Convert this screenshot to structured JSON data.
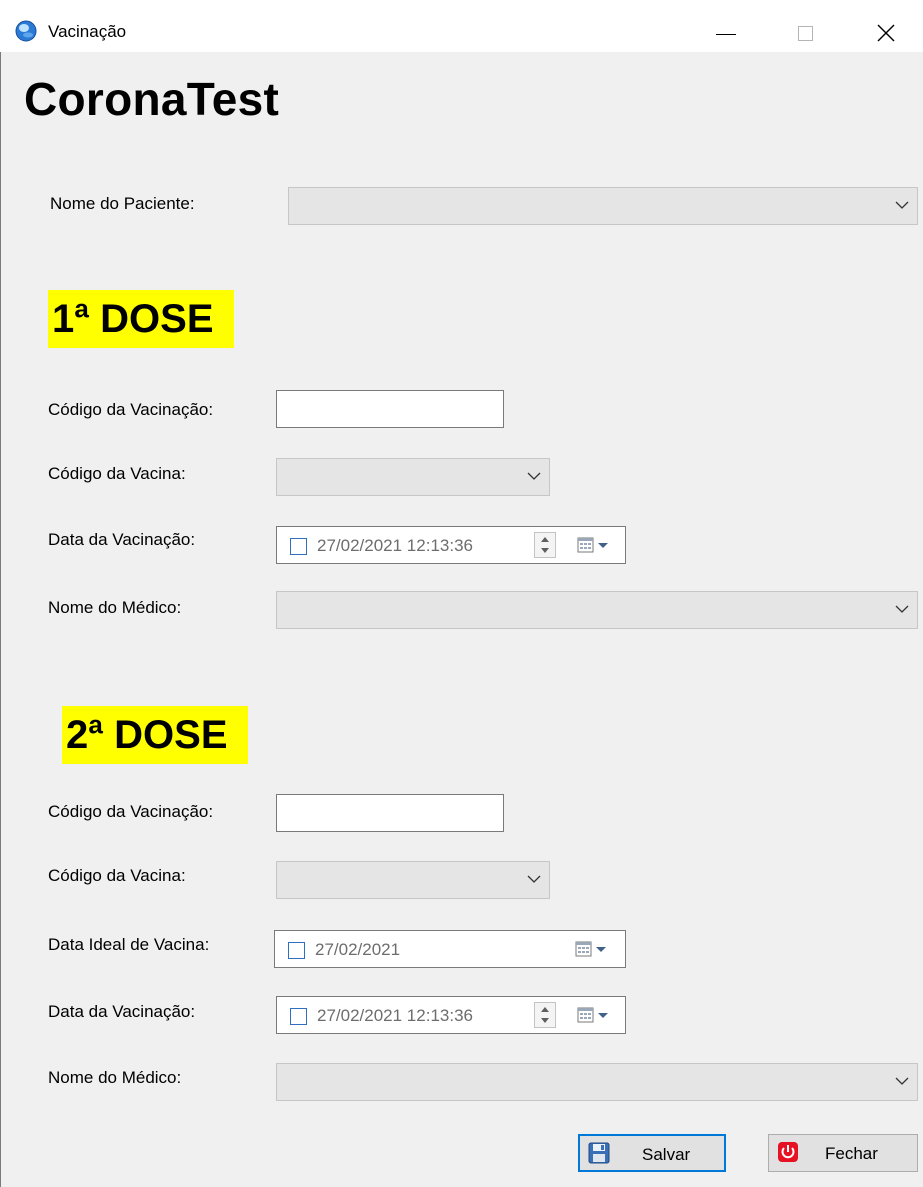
{
  "window": {
    "title": "Vacinação",
    "controls": {
      "minimize": "minimize-icon",
      "maximize": "maximize-icon",
      "close": "close-icon"
    }
  },
  "brand": "CoronaTest",
  "patient": {
    "label": "Nome do Paciente:",
    "value": ""
  },
  "dose1": {
    "heading": "1ª DOSE",
    "vaccination_code_label": "Código da Vacinação:",
    "vaccination_code_value": "",
    "vaccine_code_label": "Código da Vacina:",
    "vaccination_date_label": "Data da Vacinação:",
    "vaccination_date_value": "27/02/2021 12:13:36",
    "doctor_label": "Nome do Médico:"
  },
  "dose2": {
    "heading": "2ª DOSE",
    "vaccination_code_label": "Código da Vacinação:",
    "vaccination_code_value": "",
    "vaccine_code_label": "Código da Vacina:",
    "ideal_date_label": "Data Ideal de Vacina:",
    "ideal_date_value": "27/02/2021",
    "vaccination_date_label": "Data da Vacinação:",
    "vaccination_date_value": "27/02/2021 12:13:36",
    "doctor_label": "Nome do Médico:"
  },
  "buttons": {
    "save": "Salvar",
    "close": "Fechar"
  },
  "colors": {
    "dose_highlight": "#ffff00",
    "accent": "#0078d7",
    "close_icon": "#e81123"
  }
}
